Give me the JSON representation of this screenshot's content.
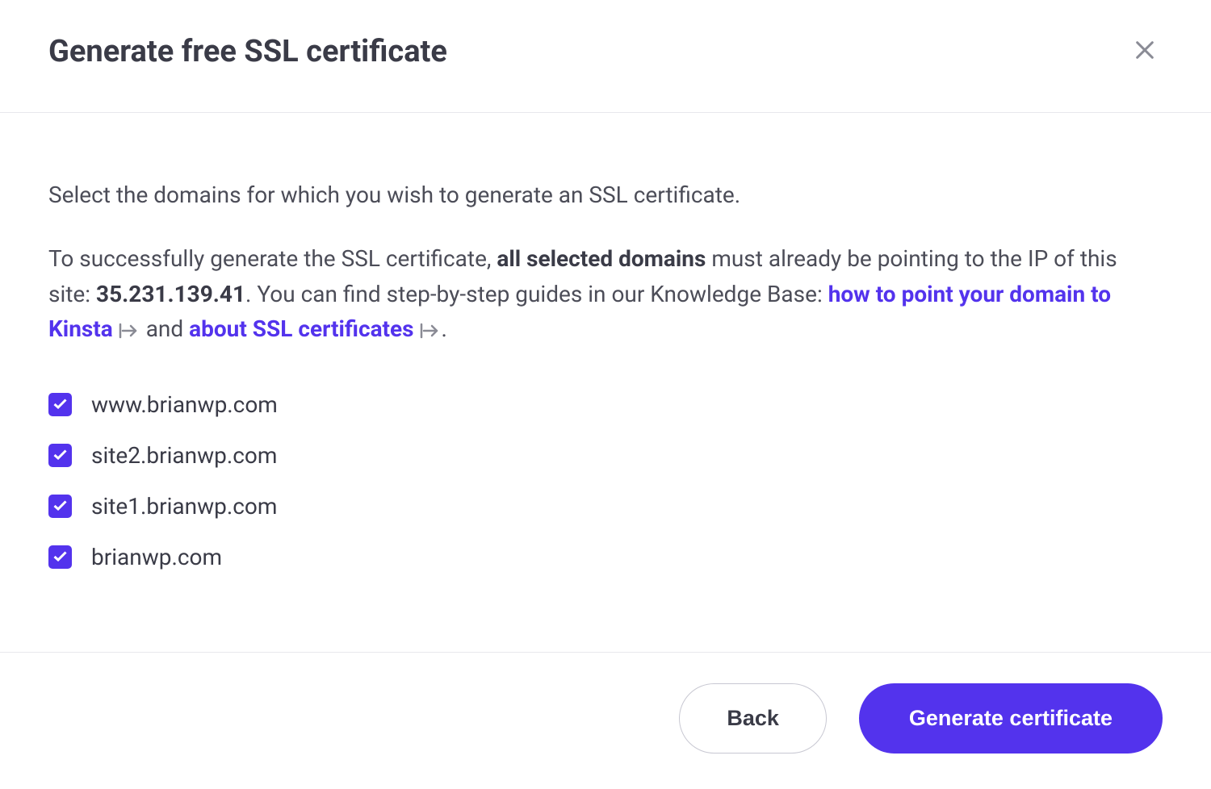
{
  "header": {
    "title": "Generate free SSL certificate"
  },
  "body": {
    "intro": "Select the domains for which you wish to generate an SSL certificate.",
    "info_pre": "To successfully generate the SSL certificate, ",
    "info_bold1": "all selected domains",
    "info_mid1": " must already be pointing to the IP of this site: ",
    "info_ip": "35.231.139.41",
    "info_mid2": ". You can find step-by-step guides in our Knowledge Base: ",
    "link1": "how to point your domain to Kinsta",
    "info_and": " and ",
    "link2": "about SSL certificates",
    "info_end": "."
  },
  "domains": [
    {
      "label": "www.brianwp.com",
      "checked": true
    },
    {
      "label": "site2.brianwp.com",
      "checked": true
    },
    {
      "label": "site1.brianwp.com",
      "checked": true
    },
    {
      "label": "brianwp.com",
      "checked": true
    }
  ],
  "footer": {
    "back": "Back",
    "generate": "Generate certificate"
  }
}
